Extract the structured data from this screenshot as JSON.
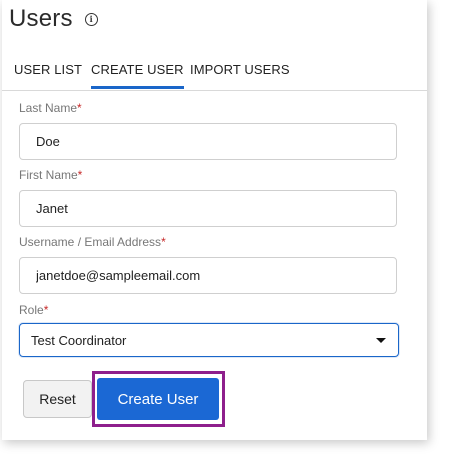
{
  "header": {
    "title": "Users",
    "info_icon": "info-circle-icon"
  },
  "tabs": [
    {
      "label": "USER LIST",
      "active": false
    },
    {
      "label": "CREATE USER",
      "active": true
    },
    {
      "label": "IMPORT USERS",
      "active": false
    }
  ],
  "form": {
    "last_name": {
      "label": "Last Name",
      "required_mark": "*",
      "value": "Doe"
    },
    "first_name": {
      "label": "First Name",
      "required_mark": "*",
      "value": "Janet"
    },
    "username": {
      "label": "Username / Email Address",
      "required_mark": "*",
      "value": "janetdoe@sampleemail.com"
    },
    "role": {
      "label": "Role",
      "required_mark": "*",
      "selected": "Test Coordinator",
      "icon": "chevron-down-icon"
    }
  },
  "actions": {
    "reset_label": "Reset",
    "create_label": "Create User"
  },
  "colors": {
    "accent": "#1b68d4",
    "required": "#c62828",
    "highlight": "#8e1f8c"
  }
}
